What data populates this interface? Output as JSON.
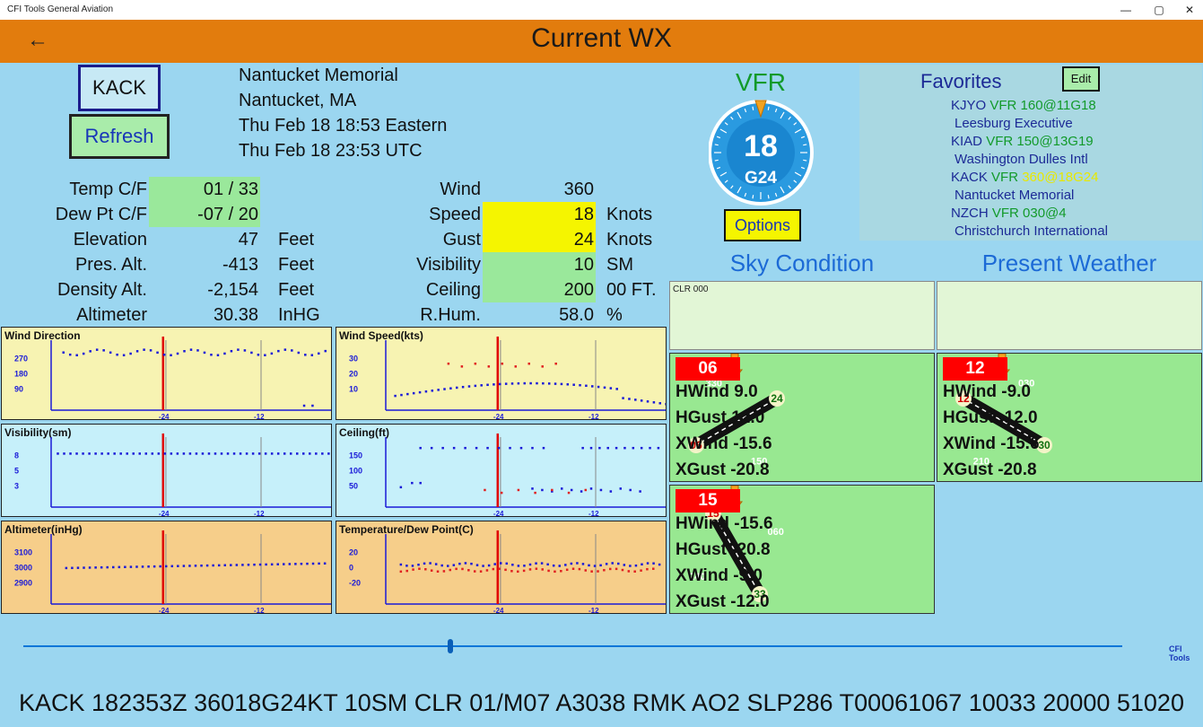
{
  "window": {
    "title": "CFI Tools General Aviation",
    "minimize": "—",
    "maximize": "▢",
    "close": "✕"
  },
  "header": {
    "title": "Current WX",
    "back_icon": "←"
  },
  "station": {
    "id": "KACK",
    "refresh_label": "Refresh"
  },
  "info": {
    "name": "Nantucket Memorial",
    "city": "Nantucket, MA",
    "local_time": "Thu Feb 18 18:53 Eastern",
    "utc_time": "Thu Feb 18 23:53 UTC"
  },
  "left_table": [
    {
      "label": "Temp C/F",
      "value": "01 / 33",
      "unit": "",
      "status": "green"
    },
    {
      "label": "Dew Pt C/F",
      "value": "-07 / 20",
      "unit": "",
      "status": "green"
    },
    {
      "label": "Elevation",
      "value": "47",
      "unit": "Feet",
      "status": ""
    },
    {
      "label": "Pres. Alt.",
      "value": "-413",
      "unit": "Feet",
      "status": ""
    },
    {
      "label": "Density Alt.",
      "value": "-2,154",
      "unit": "Feet",
      "status": ""
    },
    {
      "label": "Altimeter",
      "value": "30.38",
      "unit": "InHG",
      "status": ""
    }
  ],
  "right_table": [
    {
      "label": "Wind",
      "value": "360",
      "unit": "",
      "status": ""
    },
    {
      "label": "Speed",
      "value": "18",
      "unit": "Knots",
      "status": "yellow"
    },
    {
      "label": "Gust",
      "value": "24",
      "unit": "Knots",
      "status": "yellow"
    },
    {
      "label": "Visibility",
      "value": "10",
      "unit": "SM",
      "status": "green"
    },
    {
      "label": "Ceiling",
      "value": "200",
      "unit": "00 FT.",
      "status": "green"
    },
    {
      "label": "R.Hum.",
      "value": "58.0",
      "unit": "%",
      "status": ""
    }
  ],
  "flight_rules": {
    "category": "VFR",
    "wind_speed": "18",
    "gust": "G24",
    "options_label": "Options"
  },
  "favorites": {
    "title": "Favorites",
    "edit_label": "Edit",
    "items": [
      {
        "id": "KJYO",
        "cat": "VFR",
        "wind": "160@11G18",
        "name": "Leesburg Executive",
        "current": false
      },
      {
        "id": "KIAD",
        "cat": "VFR",
        "wind": "150@13G19",
        "name": "Washington Dulles Intl",
        "current": false
      },
      {
        "id": "KACK",
        "cat": "VFR",
        "wind": "360@18G24",
        "name": "Nantucket Memorial",
        "current": true
      },
      {
        "id": "NZCH",
        "cat": "VFR",
        "wind": "030@4",
        "name": "Christchurch International",
        "current": false
      }
    ]
  },
  "sky_condition": {
    "title": "Sky Condition",
    "text": "CLR 000"
  },
  "present_weather": {
    "title": "Present Weather",
    "text": ""
  },
  "runways": [
    {
      "number": "06",
      "hwind": "HWind  9.0",
      "hgust": "HGust  12.0",
      "xwind": "XWind  -15.6",
      "xgust": "XGust  -20.8",
      "end_a": "06",
      "end_b": "24",
      "cross_a": "330",
      "cross_b": "150"
    },
    {
      "number": "12",
      "hwind": "HWind  -9.0",
      "hgust": "HGust  -12.0",
      "xwind": "XWind  -15.6",
      "xgust": "XGust  -20.8",
      "end_a": "12",
      "end_b": "30",
      "cross_a": "030",
      "cross_b": "210"
    },
    {
      "number": "15",
      "hwind": "HWind  -15.6",
      "hgust": "HGust  -20.8",
      "xwind": "XWind   -9.0",
      "xgust": "XGust  -12.0",
      "end_a": "15",
      "end_b": "33",
      "cross_a": "060",
      "cross_b": "240"
    }
  ],
  "charts": [
    {
      "title": "Wind Direction",
      "yticks": [
        "270",
        "180",
        "90"
      ],
      "xticks": [
        "-24",
        "-12"
      ]
    },
    {
      "title": "Wind Speed(kts)",
      "yticks": [
        "30",
        "20",
        "10"
      ],
      "xticks": [
        "-24",
        "-12"
      ]
    },
    {
      "title": "Visibility(sm)",
      "yticks": [
        "8",
        "5",
        "3"
      ],
      "xticks": [
        "-24",
        "-12"
      ]
    },
    {
      "title": "Ceiling(ft)",
      "yticks": [
        "150",
        "100",
        "50"
      ],
      "xticks": [
        "-24",
        "-12"
      ]
    },
    {
      "title": "Altimeter(inHg)",
      "yticks": [
        "3100",
        "3000",
        "2900"
      ],
      "xticks": [
        "-24",
        "-12"
      ]
    },
    {
      "title": "Temperature/Dew Point(C)",
      "yticks": [
        "20",
        "0",
        "-20"
      ],
      "xticks": [
        "-24",
        "-12"
      ]
    }
  ],
  "timeline": {
    "brand": "CFI Tools",
    "position": 0.39
  },
  "metar": "KACK 182353Z 36018G24KT 10SM CLR 01/M07 A3038 RMK AO2 SLP286 T00061067 10033 20000 51020",
  "colors": {
    "header": "#e27c0d",
    "background": "#9bd6f0",
    "vfr": "#129a2a",
    "runway_number": "#ff0000",
    "marker": "#e00000",
    "series_blue": "#1a1ad8",
    "series_red": "#e02020"
  }
}
